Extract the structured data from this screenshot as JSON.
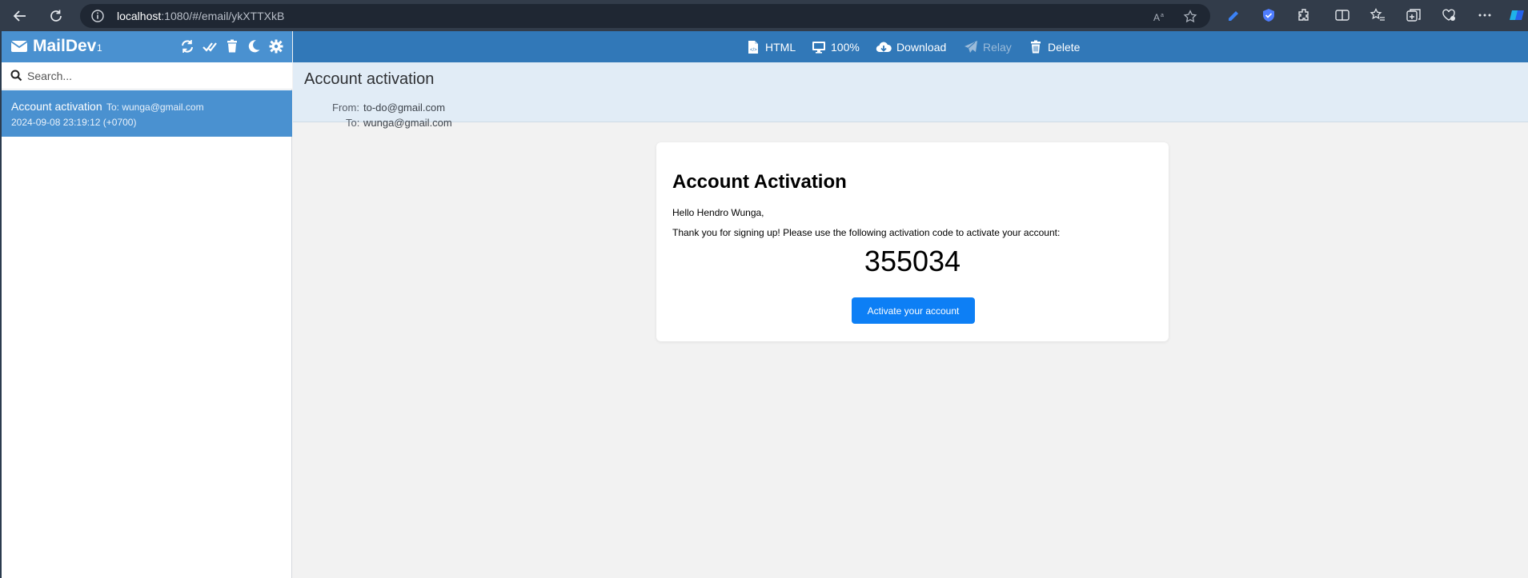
{
  "browser": {
    "url_host": "localhost",
    "url_rest": ":1080/#/email/ykXTTXkB"
  },
  "sidebar": {
    "brand": "MailDev",
    "count": "1",
    "search_placeholder": "Search...",
    "emails": [
      {
        "subject": "Account activation",
        "to": "To: wunga@gmail.com",
        "date": "2024-09-08 23:19:12 (+0700)"
      }
    ]
  },
  "toolbar": {
    "html_label": "HTML",
    "zoom_label": "100%",
    "download_label": "Download",
    "relay_label": "Relay",
    "delete_label": "Delete"
  },
  "email": {
    "subject": "Account activation",
    "from_label": "From:",
    "from_value": "to-do@gmail.com",
    "to_label": "To:",
    "to_value": "wunga@gmail.com",
    "body": {
      "heading": "Account Activation",
      "greeting": "Hello Hendro Wunga,",
      "message": "Thank you for signing up! Please use the following activation code to activate your account:",
      "code": "355034",
      "button_label": "Activate your account"
    }
  },
  "colors": {
    "header_blue": "#4a91d0",
    "toolbar_blue": "#3178b8",
    "button_blue": "#0d7ff5"
  },
  "icons": [
    "back-icon",
    "reload-icon",
    "info-icon",
    "read-aloud-icon",
    "favorite-star-icon",
    "extension-icon",
    "split-screen-icon",
    "favorites-icon",
    "collections-icon",
    "heart-icon",
    "more-icon",
    "envelope-icon",
    "refresh-icon",
    "mark-read-icon",
    "trash-icon",
    "moon-icon",
    "gear-icon",
    "search-icon",
    "file-code-icon",
    "monitor-icon",
    "cloud-download-icon",
    "paper-plane-icon"
  ]
}
